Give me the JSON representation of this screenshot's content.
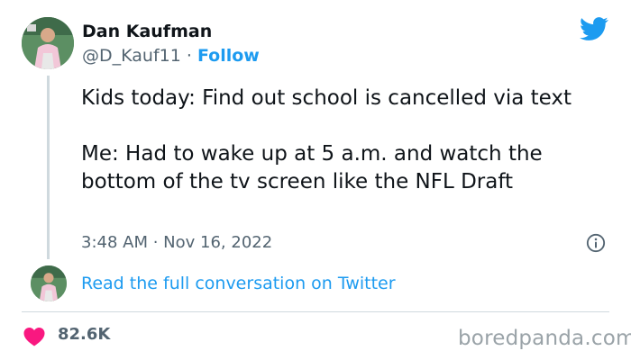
{
  "author": {
    "name": "Dan Kaufman",
    "handle": "@D_Kauf11",
    "separator": " · ",
    "follow_label": "Follow"
  },
  "tweet": {
    "paragraphs": [
      "Kids today: Find out school is cancelled via text",
      "Me: Had to wake up at 5 a.m. and watch the bottom of the tv screen like the NFL Draft"
    ],
    "time": "3:48 AM",
    "date_separator": " · ",
    "date": "Nov 16, 2022"
  },
  "read_full_label": "Read the full conversation on Twitter",
  "likes": {
    "count": "82.6K"
  },
  "watermark": "boredpanda.com",
  "icons": {
    "brand": "twitter-bird-icon",
    "info": "info-icon",
    "like": "heart-icon"
  },
  "colors": {
    "accent": "#1d9bf0",
    "heart": "#f91880",
    "text": "#0f1419",
    "secondary": "#536471"
  }
}
